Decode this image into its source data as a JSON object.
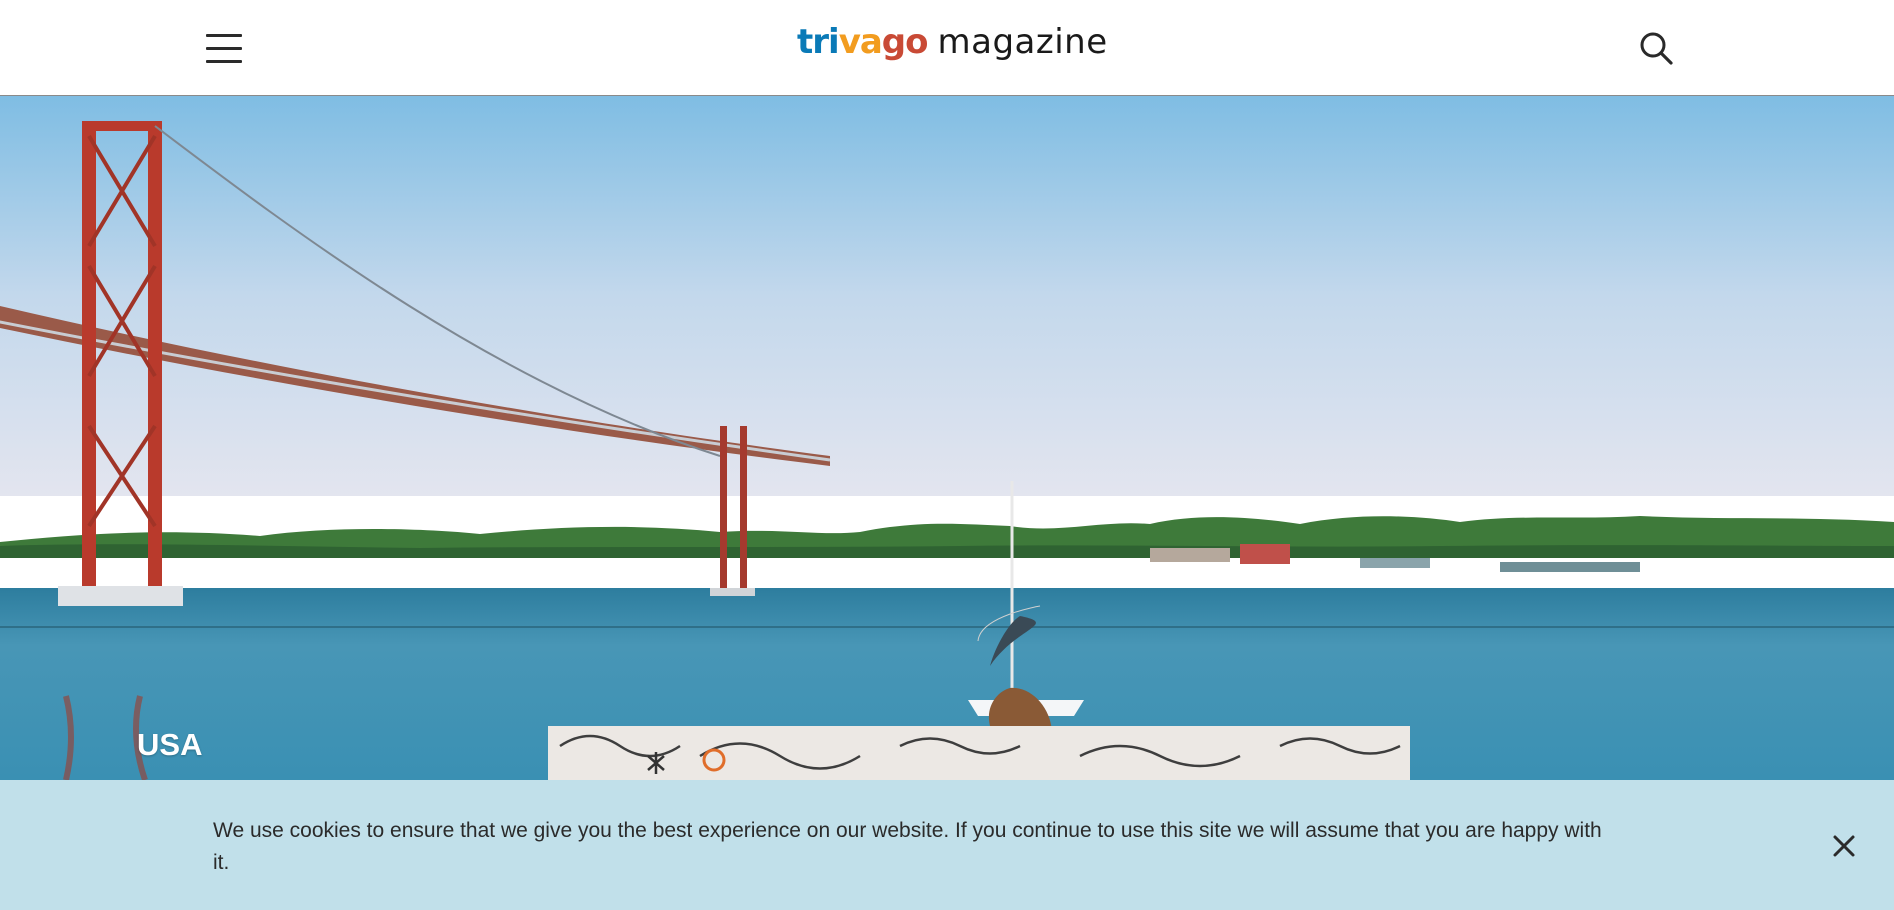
{
  "header": {
    "menu_icon": "hamburger-icon",
    "logo": {
      "part1": "tri",
      "part2": "va",
      "part3": "go",
      "suffix": "magazine"
    },
    "search_icon": "search-icon"
  },
  "hero": {
    "category_label": "USA"
  },
  "cookie_banner": {
    "message": "We use cookies to ensure that we give you the best experience on our website. If you continue to use this site we will assume that you are happy with it.",
    "close_icon": "close-icon"
  },
  "colors": {
    "brand_blue": "#0a7ab7",
    "brand_orange": "#f29c1f",
    "brand_red": "#c94a35",
    "cookie_bg": "#c1e0ea"
  }
}
